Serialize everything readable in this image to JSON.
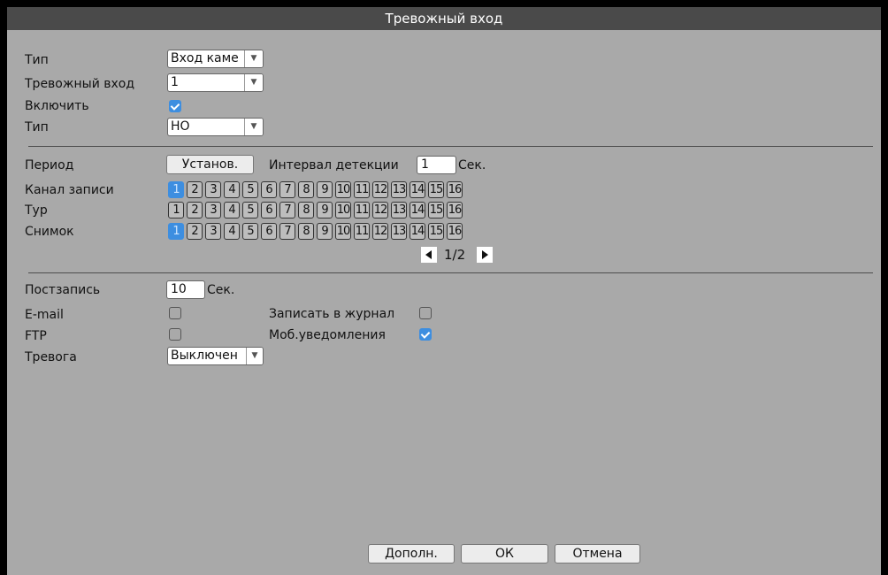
{
  "window": {
    "title": "Тревожный вход"
  },
  "general": {
    "type_label": "Тип",
    "type_value": "Вход каме",
    "alarm_input_label": "Тревожный вход",
    "alarm_input_value": "1",
    "enable_label": "Включить",
    "enable_checked": true,
    "device_type_label": "Тип",
    "device_type_value": "НО"
  },
  "schedule": {
    "period_label": "Период",
    "set_button": "Установ.",
    "interval_label": "Интервал детекции",
    "interval_value": "1",
    "interval_unit": "Сек."
  },
  "channels": {
    "rows": [
      {
        "label": "Канал записи",
        "selected": [
          "1"
        ]
      },
      {
        "label": "Тур",
        "selected": []
      },
      {
        "label": "Снимок",
        "selected": [
          "1"
        ]
      }
    ],
    "numbers": [
      "1",
      "2",
      "3",
      "4",
      "5",
      "6",
      "7",
      "8",
      "9",
      "10",
      "11",
      "12",
      "13",
      "14",
      "15",
      "16"
    ],
    "page": "1/2"
  },
  "actions": {
    "post_record_label": "Постзапись",
    "post_record_value": "10",
    "post_record_unit": "Сек.",
    "email_label": "E-mail",
    "email_checked": false,
    "log_label": "Записать в журнал",
    "log_checked": false,
    "ftp_label": "FTP",
    "ftp_checked": false,
    "mobile_label": "Моб.уведомления",
    "mobile_checked": true,
    "alarm_label": "Тревога",
    "alarm_value": "Выключен"
  },
  "footer": {
    "advanced_button": "Дополн.",
    "ok_button": "ОК",
    "cancel_button": "Отмена"
  },
  "colors": {
    "accent": "#3d8ee0",
    "title_bg": "#4a4a4a",
    "panel_bg": "#a9a9a9"
  }
}
